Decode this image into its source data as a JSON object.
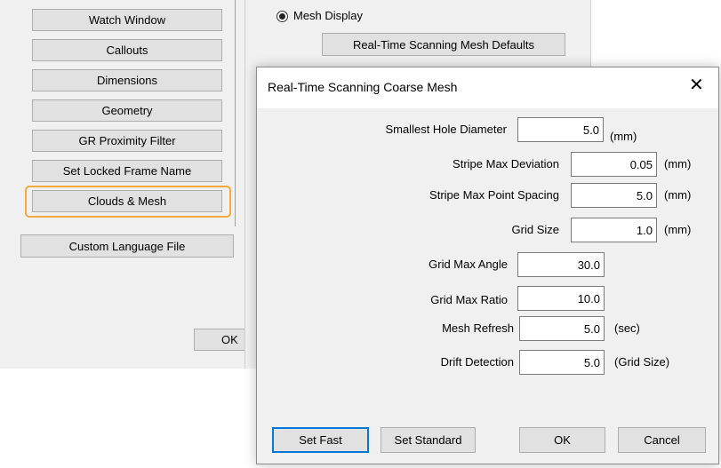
{
  "left_panel": {
    "buttons": [
      "Watch Window",
      "Callouts",
      "Dimensions",
      "Geometry",
      "GR Proximity Filter",
      "Set Locked Frame Name",
      "Clouds & Mesh"
    ],
    "custom_language_button": "Custom Language File",
    "ok_button": "OK"
  },
  "mid_dialog": {
    "radio_label": "Mesh Display",
    "defaults_button": "Real-Time Scanning Mesh Defaults"
  },
  "dialog": {
    "title": "Real-Time Scanning Coarse Mesh",
    "close_icon": "close-icon",
    "fields": [
      {
        "label": "Smallest Hole Diameter",
        "value": "5.0",
        "unit": "(mm)"
      },
      {
        "label": "Stripe Max Deviation",
        "value": "0.05",
        "unit": "(mm)"
      },
      {
        "label": "Stripe Max Point Spacing",
        "value": "5.0",
        "unit": "(mm)"
      },
      {
        "label": "Grid Size",
        "value": "1.0",
        "unit": "(mm)"
      },
      {
        "label": "Grid Max Angle",
        "value": "30.0",
        "unit": ""
      },
      {
        "label": "Grid Max Ratio",
        "value": "10.0",
        "unit": ""
      },
      {
        "label": "Mesh Refresh",
        "value": "5.0",
        "unit": "(sec)"
      },
      {
        "label": "Drift Detection",
        "value": "5.0",
        "unit": "(Grid Size)"
      }
    ],
    "buttons": {
      "set_fast": "Set Fast",
      "set_standard": "Set Standard",
      "ok": "OK",
      "cancel": "Cancel"
    }
  },
  "colors": {
    "highlight": "#f2a93b",
    "panel_bg": "#f0f0f0",
    "button_bg": "#e1e1e1",
    "focus_border": "#0078d7"
  }
}
